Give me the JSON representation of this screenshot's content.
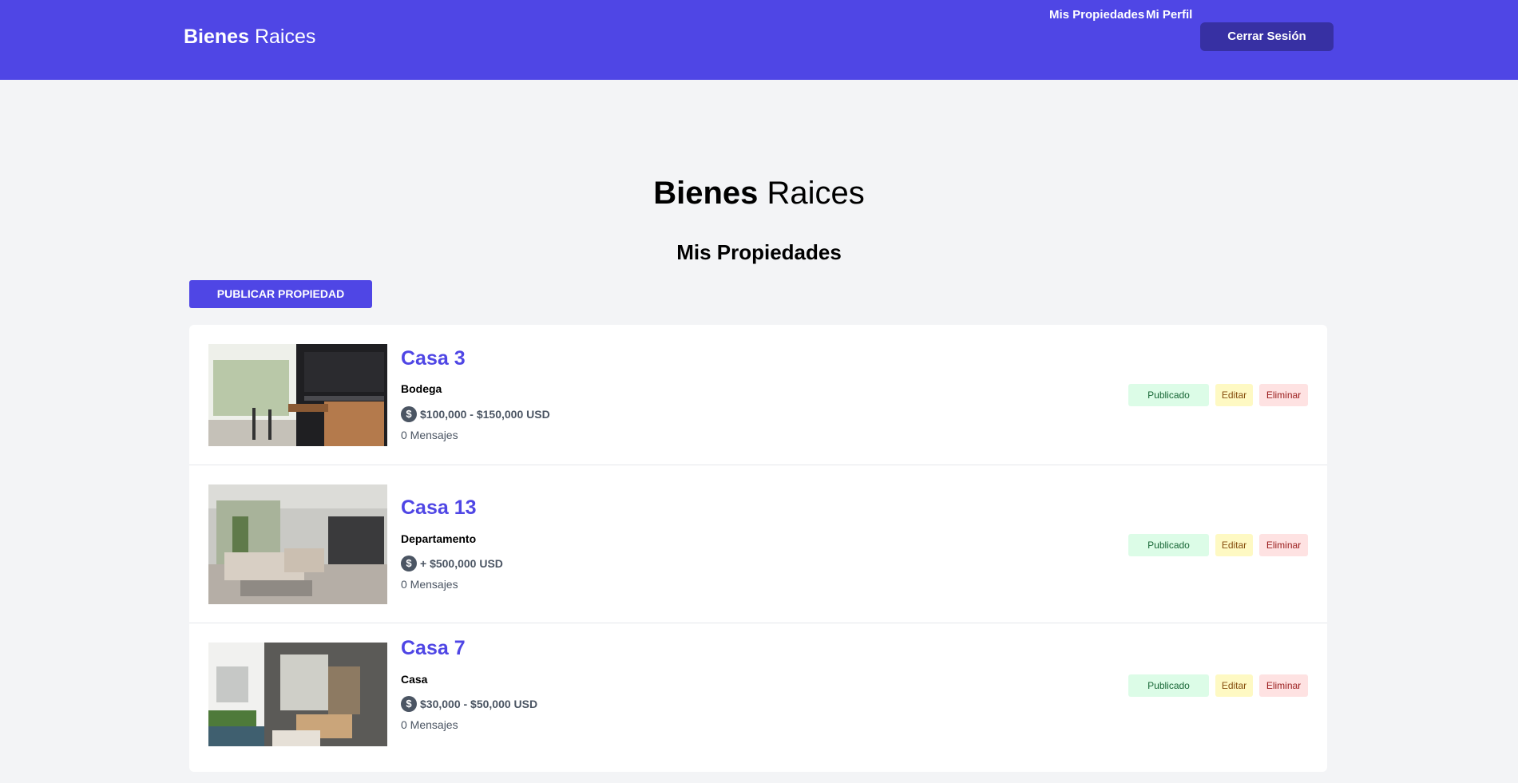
{
  "header": {
    "brand_bold": "Bienes",
    "brand_light": "Raices",
    "nav": {
      "mis_propiedades": "Mis Propiedades",
      "mi_perfil": "Mi Perfil",
      "cerrar_sesion": "Cerrar Sesión"
    }
  },
  "main": {
    "title_bold": "Bienes",
    "title_light": "Raices",
    "section_title": "Mis Propiedades",
    "publish_label": "Publicar Propiedad"
  },
  "properties": [
    {
      "title": "Casa 3",
      "category": "Bodega",
      "price": "$100,000 - $150,000 USD",
      "messages": "0 Mensajes",
      "status": "Publicado",
      "edit": "Editar",
      "delete": "Eliminar"
    },
    {
      "title": "Casa 13",
      "category": "Departamento",
      "price": "+ $500,000 USD",
      "messages": "0 Mensajes",
      "status": "Publicado",
      "edit": "Editar",
      "delete": "Eliminar"
    },
    {
      "title": "Casa 7",
      "category": "Casa",
      "price": "$30,000 - $50,000 USD",
      "messages": "0 Mensajes",
      "status": "Publicado",
      "edit": "Editar",
      "delete": "Eliminar"
    }
  ],
  "colors": {
    "primary": "#4f46e5",
    "primary_dark": "#3730a3",
    "background": "#f3f4f6"
  }
}
